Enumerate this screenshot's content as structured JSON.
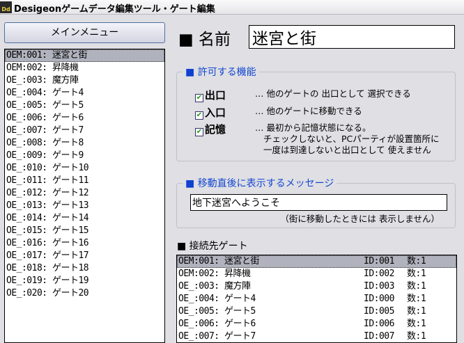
{
  "window": {
    "title": "Desigeonゲームデータ編集ツール・ゲート編集",
    "icon": "Dd"
  },
  "sidebar": {
    "menu_button": "メインメニュー",
    "gates": [
      "OEM:001: 迷宮と街",
      "OEM:002: 昇降機",
      "OE_:003: 魔方陣",
      "OE_:004: ゲート4",
      "OE_:005: ゲート5",
      "OE_:006: ゲート6",
      "OE_:007: ゲート7",
      "OE_:008: ゲート8",
      "OE_:009: ゲート9",
      "OE_:010: ゲート10",
      "OE_:011: ゲート11",
      "OE_:012: ゲート12",
      "OE_:013: ゲート13",
      "OE_:014: ゲート14",
      "OE_:015: ゲート15",
      "OE_:016: ゲート16",
      "OE_:017: ゲート17",
      "OE_:018: ゲート18",
      "OE_:019: ゲート19",
      "OE_:020: ゲート20"
    ],
    "selected_index": 0
  },
  "name": {
    "label": "■ 名前",
    "value": "迷宮と街"
  },
  "features": {
    "legend": "許可する機能",
    "items": [
      {
        "label": "出口",
        "checked": true,
        "desc": "… 他のゲートの 出口として 選択できる"
      },
      {
        "label": "入口",
        "checked": true,
        "desc": "… 他のゲートに移動できる"
      },
      {
        "label": "記憶",
        "checked": true,
        "desc": "… 最初から記憶状態になる。",
        "desc2": "チェックしないと、PCパーティが設置箇所に",
        "desc3": "一度は到達しないと出口として 使えません"
      }
    ]
  },
  "message": {
    "legend": "移動直後に表示するメッセージ",
    "value": "地下迷宮へようこそ",
    "note": "（街に移動したときには 表示しません）"
  },
  "destinations": {
    "heading": "■ 接続先ゲート",
    "rows": [
      {
        "name": "OEM:001: 迷宮と街",
        "id": "ID:001",
        "count": "数:1"
      },
      {
        "name": "OEM:002: 昇降機",
        "id": "ID:002",
        "count": "数:1"
      },
      {
        "name": "OE_:003: 魔方陣",
        "id": "ID:003",
        "count": "数:1"
      },
      {
        "name": "OE_:004: ゲート4",
        "id": "ID:000",
        "count": "数:1"
      },
      {
        "name": "OE_:005: ゲート5",
        "id": "ID:005",
        "count": "数:1"
      },
      {
        "name": "OE_:006: ゲート6",
        "id": "ID:006",
        "count": "数:1"
      },
      {
        "name": "OE_:007: ゲート7",
        "id": "ID:007",
        "count": "数:1"
      }
    ],
    "selected_index": 0
  },
  "colors": {
    "accent": "#1548d0",
    "selection": "#b0b2bd",
    "check": "#1a9a1a"
  }
}
